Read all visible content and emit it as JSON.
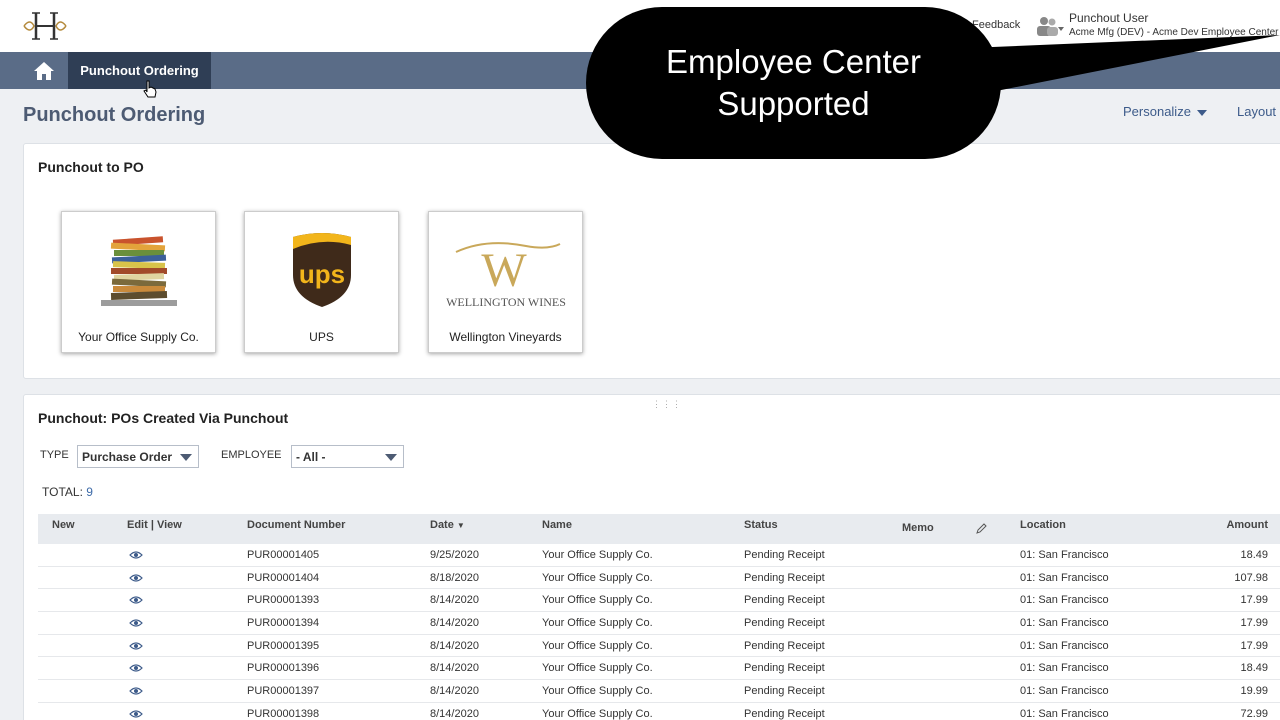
{
  "header": {
    "feedback_label": "Feedback",
    "user_name": "Punchout User",
    "user_sub": "Acme Mfg (DEV) - Acme Dev Employee Center"
  },
  "nav": {
    "active_tab": "Punchout Ordering"
  },
  "page": {
    "title": "Punchout Ordering",
    "personalize_label": "Personalize",
    "layout_label": "Layout"
  },
  "callout": {
    "line1": "Employee Center",
    "line2": "Supported"
  },
  "punchout_portlet": {
    "title": "Punchout to PO",
    "vendors": [
      {
        "label": "Your Office Supply Co.",
        "icon": "office-supply-stack-image"
      },
      {
        "label": "UPS",
        "icon": "ups-logo",
        "logo_text": "ups"
      },
      {
        "label": "Wellington Vineyards",
        "icon": "wellington-wines-logo",
        "logo_text": "WELLINGTON WINES"
      }
    ]
  },
  "po_portlet": {
    "title": "Punchout: POs Created Via Punchout",
    "type_label": "TYPE",
    "type_value": "Purchase Order",
    "employee_label": "EMPLOYEE",
    "employee_value": "- All -",
    "total_label": "TOTAL:",
    "total_value": "9",
    "columns": {
      "new": "New",
      "edit_view": "Edit | View",
      "doc_number": "Document Number",
      "date": "Date",
      "name": "Name",
      "status": "Status",
      "memo": "Memo",
      "location": "Location",
      "amount": "Amount"
    },
    "rows": [
      {
        "doc": "PUR00001405",
        "date": "9/25/2020",
        "name": "Your Office Supply Co.",
        "status": "Pending Receipt",
        "location": "01: San Francisco",
        "amount": "18.49"
      },
      {
        "doc": "PUR00001404",
        "date": "8/18/2020",
        "name": "Your Office Supply Co.",
        "status": "Pending Receipt",
        "location": "01: San Francisco",
        "amount": "107.98"
      },
      {
        "doc": "PUR00001393",
        "date": "8/14/2020",
        "name": "Your Office Supply Co.",
        "status": "Pending Receipt",
        "location": "01: San Francisco",
        "amount": "17.99"
      },
      {
        "doc": "PUR00001394",
        "date": "8/14/2020",
        "name": "Your Office Supply Co.",
        "status": "Pending Receipt",
        "location": "01: San Francisco",
        "amount": "17.99"
      },
      {
        "doc": "PUR00001395",
        "date": "8/14/2020",
        "name": "Your Office Supply Co.",
        "status": "Pending Receipt",
        "location": "01: San Francisco",
        "amount": "17.99"
      },
      {
        "doc": "PUR00001396",
        "date": "8/14/2020",
        "name": "Your Office Supply Co.",
        "status": "Pending Receipt",
        "location": "01: San Francisco",
        "amount": "18.49"
      },
      {
        "doc": "PUR00001397",
        "date": "8/14/2020",
        "name": "Your Office Supply Co.",
        "status": "Pending Receipt",
        "location": "01: San Francisco",
        "amount": "19.99"
      },
      {
        "doc": "PUR00001398",
        "date": "8/14/2020",
        "name": "Your Office Supply Co.",
        "status": "Pending Receipt",
        "location": "01: San Francisco",
        "amount": "72.99"
      }
    ]
  },
  "colors": {
    "nav_bar": "#5a6c87",
    "nav_active": "#2f3e55",
    "title_text": "#4d5b73",
    "link": "#3d5b8a",
    "ups_brown": "#3f2a1a",
    "ups_gold": "#f2b51b",
    "wellington_gold": "#c9a85a"
  }
}
